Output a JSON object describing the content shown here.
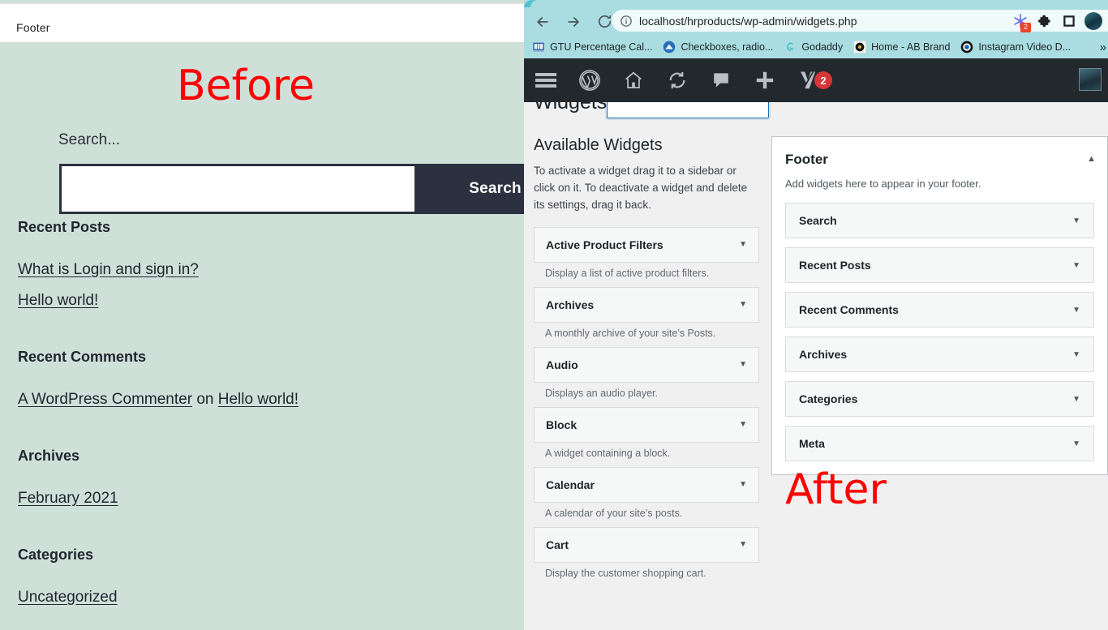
{
  "before_panel": {
    "label": "Before",
    "topbar_title": "Footer",
    "search_label": "Search...",
    "search_input_value": "",
    "search_button_label": "Search",
    "sections": [
      {
        "heading": "Recent Posts",
        "links": [
          "What is Login and sign in?",
          "Hello world!"
        ]
      },
      {
        "heading": "Recent Comments",
        "comment_author": "A WordPress Commenter",
        "comment_on": "on",
        "comment_post": "Hello world!"
      },
      {
        "heading": "Archives",
        "links": [
          "February 2021"
        ]
      },
      {
        "heading": "Categories",
        "links": [
          "Uncategorized"
        ]
      }
    ]
  },
  "after_panel": {
    "label": "After"
  },
  "browser": {
    "url": "localhost/hrproducts/wp-admin/widgets.php",
    "nav": {
      "back": "back-arrow",
      "forward": "forward-arrow",
      "reload": "reload"
    },
    "omnibox_icons": [
      "info-circle",
      "share",
      "star"
    ],
    "extensions": [
      {
        "name": "extension-snowflake",
        "badge": "2"
      },
      {
        "name": "extensions-puzzle",
        "badge": ""
      },
      {
        "name": "browser-square",
        "badge": ""
      },
      {
        "name": "profile-avatar",
        "badge": ""
      }
    ],
    "bookmarks": [
      {
        "label": "GTU Percentage Cal...",
        "favicon": "book-icon"
      },
      {
        "label": "Checkboxes, radio...",
        "favicon": "mountain-icon"
      },
      {
        "label": "Godaddy",
        "favicon": "godaddy-icon"
      },
      {
        "label": "Home - AB Brand",
        "favicon": "dot-icon"
      },
      {
        "label": "Instagram Video D...",
        "favicon": "circle-icon"
      }
    ],
    "bookmarks_overflow": "»"
  },
  "wp": {
    "adminbar": {
      "items": [
        "menu-icon",
        "wordpress-logo",
        "home-icon",
        "updates-icon",
        "comments-icon",
        "new-content-icon",
        "yoast-icon"
      ],
      "notification_count": "2"
    },
    "page_title": "Widgets",
    "search_placeholder": "",
    "search_value": "",
    "available": {
      "heading": "Available Widgets",
      "description": "To activate a widget drag it to a sidebar or click on it. To deactivate a widget and delete its settings, drag it back.",
      "widgets": [
        {
          "title": "Active Product Filters",
          "desc": "Display a list of active product filters."
        },
        {
          "title": "Archives",
          "desc": "A monthly archive of your site’s Posts."
        },
        {
          "title": "Audio",
          "desc": "Displays an audio player."
        },
        {
          "title": "Block",
          "desc": "A widget containing a block."
        },
        {
          "title": "Calendar",
          "desc": "A calendar of your site’s posts."
        },
        {
          "title": "Cart",
          "desc": "Display the customer shopping cart."
        }
      ]
    },
    "footer_sidebar": {
      "title": "Footer",
      "description": "Add widgets here to appear in your footer.",
      "toggle": "▲",
      "widgets": [
        {
          "title": "Search"
        },
        {
          "title": "Recent Posts"
        },
        {
          "title": "Recent Comments"
        },
        {
          "title": "Archives"
        },
        {
          "title": "Categories"
        },
        {
          "title": "Meta"
        }
      ]
    },
    "caret": "▼"
  },
  "colors": {
    "footer_bg": "#cfe0d8",
    "accent_red": "#ff0000",
    "browser_chrome": "#aadde2",
    "wp_adminbar": "#23282d",
    "wp_page_bg": "#f0f0f1"
  }
}
